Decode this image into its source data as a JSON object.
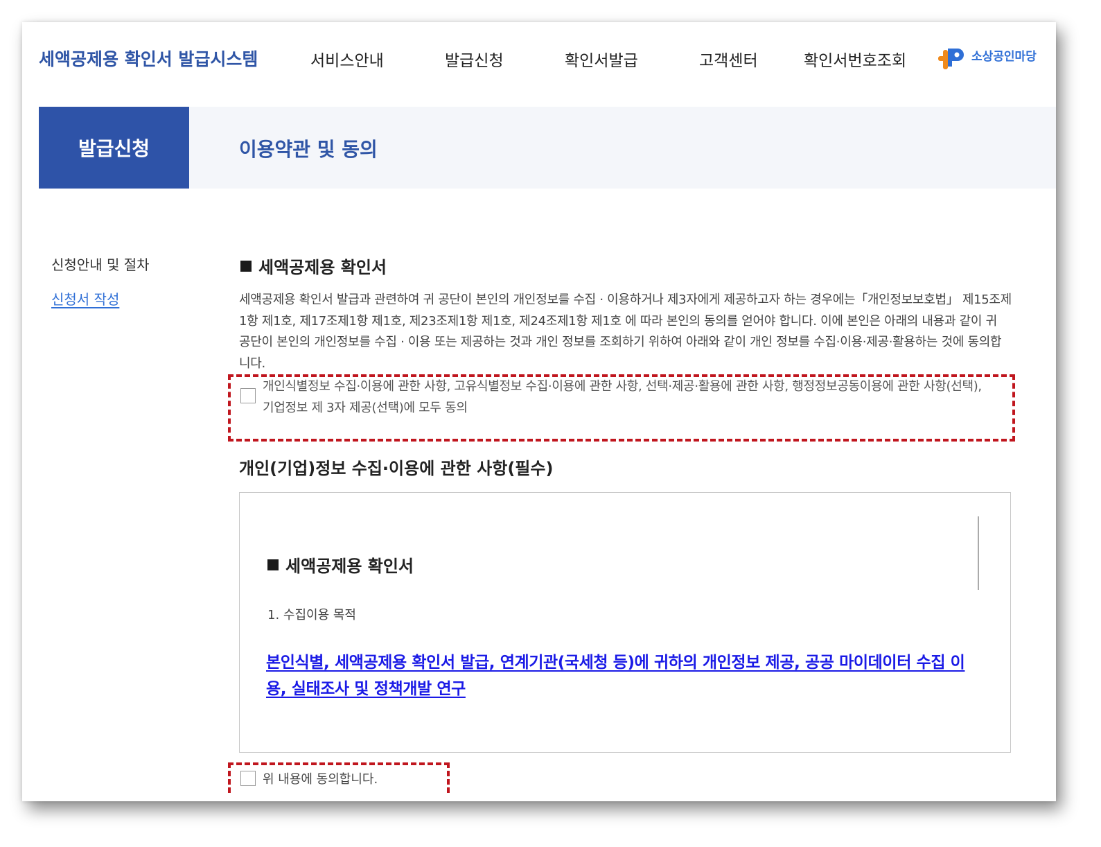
{
  "header": {
    "site_title": "세액공제용 확인서 발급시스템",
    "nav": [
      "서비스안내",
      "발급신청",
      "확인서발급",
      "고객센터",
      "확인서번호조회"
    ],
    "brand_name": "소상공인마당"
  },
  "banner": {
    "section": "발급신청",
    "title": "이용약관 및 동의"
  },
  "sidebar": {
    "items": [
      {
        "label": "신청안내 및 절차"
      },
      {
        "label": "신청서 작성"
      }
    ]
  },
  "content": {
    "section_title": "세액공제용 확인서",
    "description": "세액공제용 확인서 발급과 관련하여 귀 공단이 본인의 개인정보를 수집 · 이용하거나 제3자에게 제공하고자 하는 경우에는「개인정보보호법」 제15조제1항 제1호, 제17조제1항 제1호, 제23조제1항 제1호, 제24조제1항 제1호 에 따라 본인의 동의를 얻어야 합니다. 이에 본인은 아래의 내용과 같이 귀 공단이 본인의 개인정보를 수집 · 이용 또는 제공하는 것과 개인 정보를 조회하기 위하여 아래와 같이 개인 정보를 수집·이용·제공·활용하는 것에 동의합니다.",
    "agree_all_label": "개인식별정보 수집·이용에 관한 사항, 고유식별정보 수집·이용에 관한 사항, 선택·제공·활용에 관한 사항, 행정정보공동이용에 관한 사항(선택), 기업정보 제 3자 제공(선택)에 모두 동의",
    "sub_title": "개인(기업)정보 수집·이용에 관한 사항(필수)",
    "terms": {
      "title": "세액공제용 확인서",
      "item1": "1. 수집이용 목적",
      "purpose_link": "본인식별, 세액공제용 확인서 발급, 연계기관(국세청 등)에 귀하의 개인정보 제공, 공공 마이데이터 수집 이용, 실태조사 및 정책개발 연구"
    },
    "agree_label": "위 내용에 동의합니다."
  },
  "colors": {
    "brand_blue": "#2f55a6",
    "banner_box": "#2e53a8",
    "link_blue": "#1a1ae6",
    "highlight_red": "#c0161e",
    "logo_blue": "#2f6fd6",
    "logo_orange": "#f08a1c"
  }
}
